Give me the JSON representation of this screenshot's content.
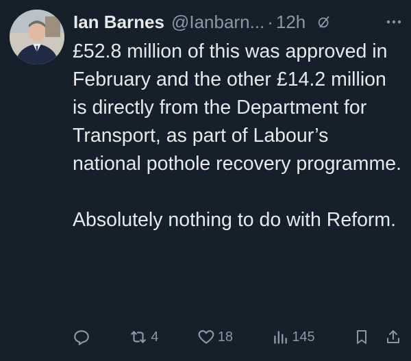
{
  "author": {
    "name": "Ian Barnes",
    "handle": "@Ianbarn...",
    "separator": "·",
    "time": "12h"
  },
  "tweet": {
    "paragraph1": "£52.8 million of this was approved in February and the other £14.2 million is directly from the Department for Transport, as part of Labour’s national pothole recovery programme.",
    "paragraph2": "Absolutely nothing to do with Reform."
  },
  "actions": {
    "retweets": "4",
    "likes": "18",
    "views": "145"
  },
  "icons": {
    "header": [
      "grok-icon",
      "more-icon"
    ],
    "actions": [
      "reply-icon",
      "retweet-icon",
      "like-icon",
      "views-icon",
      "bookmark-icon",
      "share-icon"
    ]
  },
  "colors": {
    "background": "#15202b",
    "text": "#e7e9ea",
    "muted": "#8b98a5"
  }
}
